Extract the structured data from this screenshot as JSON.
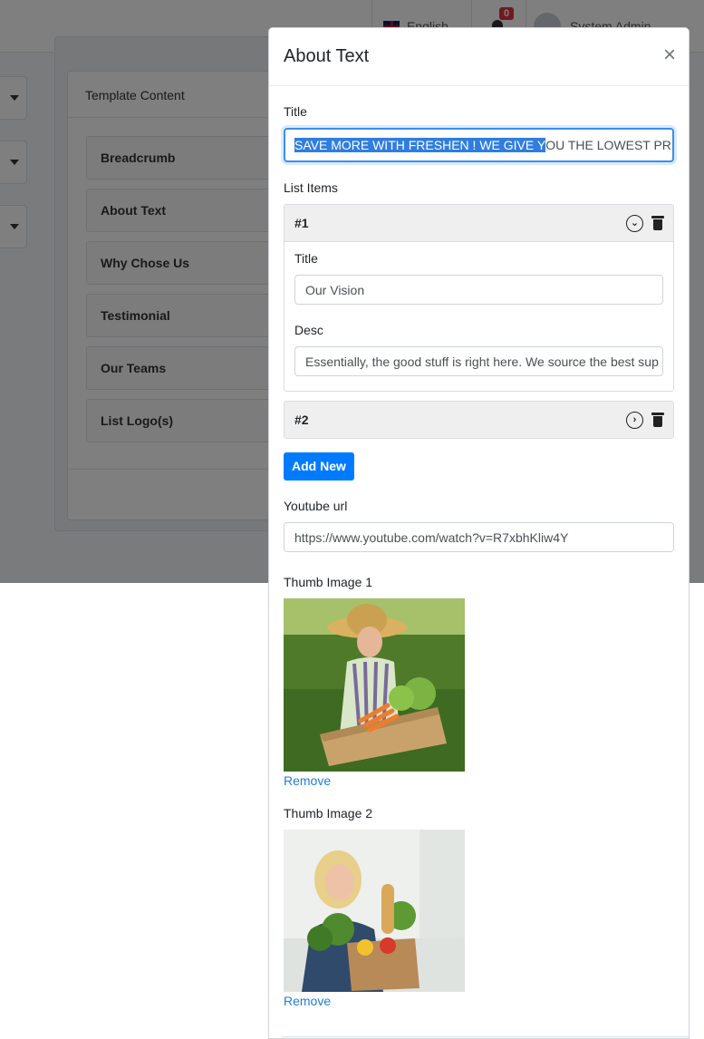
{
  "header": {
    "language": "English",
    "notifications_count": "0",
    "user_name": "System Admin"
  },
  "background": {
    "card_title": "Template Content",
    "template_items": [
      "Breadcrumb",
      "About Text",
      "Why Chose Us",
      "Testimonial",
      "Our Teams",
      "List Logo(s)"
    ]
  },
  "modal": {
    "title": "About Text",
    "close_label": "×",
    "title_field": {
      "label": "Title",
      "value_selected": "SAVE MORE WITH FRESHEN ! WE GIVE Y",
      "value_rest": "OU THE LOWEST PRICES C"
    },
    "list_items": {
      "label": "List Items",
      "items": [
        {
          "number": "#1",
          "expanded": true,
          "title_label": "Title",
          "title_value": "Our Vision",
          "desc_label": "Desc",
          "desc_value": "Essentially, the good stuff is right here. We source the best sup"
        },
        {
          "number": "#2",
          "expanded": false
        }
      ],
      "add_button": "Add New"
    },
    "youtube": {
      "label": "Youtube url",
      "value": "https://www.youtube.com/watch?v=R7xbhKliw4Y"
    },
    "thumb1": {
      "label": "Thumb Image 1",
      "remove": "Remove"
    },
    "thumb2": {
      "label": "Thumb Image 2",
      "remove": "Remove"
    }
  }
}
